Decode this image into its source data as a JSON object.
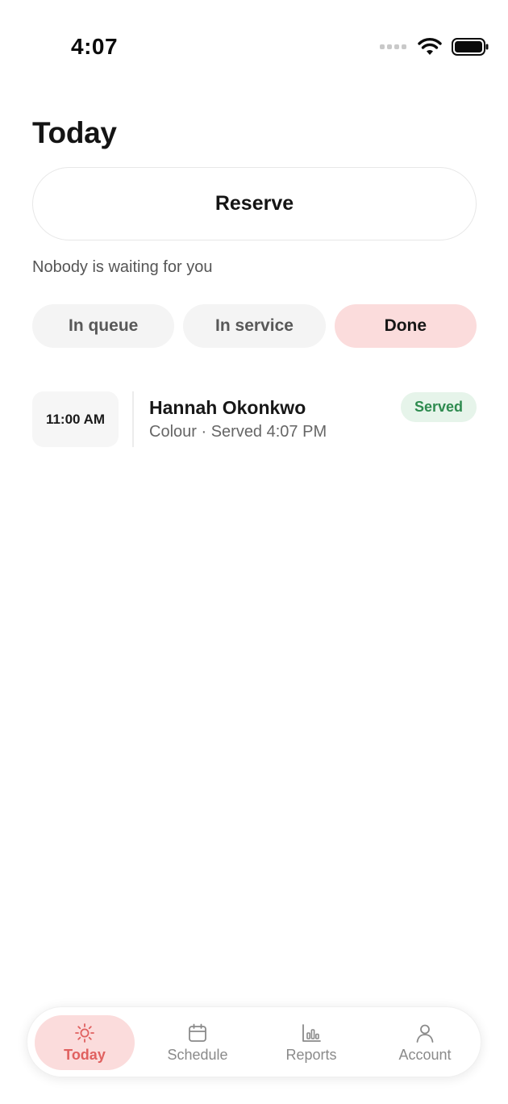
{
  "status_bar": {
    "time": "4:07",
    "icons": [
      "signal-dots-icon",
      "wifi-icon",
      "battery-icon"
    ]
  },
  "page": {
    "title": "Today"
  },
  "reserve": {
    "label": "Reserve"
  },
  "queue_message": "Nobody is waiting for you",
  "tabs": [
    {
      "label": "In queue",
      "active": false
    },
    {
      "label": "In service",
      "active": false
    },
    {
      "label": "Done",
      "active": true
    }
  ],
  "items": [
    {
      "time": "11:00 AM",
      "name": "Hannah Okonkwo",
      "detail": "Colour · Served 4:07 PM",
      "status": "Served"
    }
  ],
  "bottom_nav": [
    {
      "label": "Today",
      "icon": "sun-icon",
      "active": true
    },
    {
      "label": "Schedule",
      "icon": "calendar-icon",
      "active": false
    },
    {
      "label": "Reports",
      "icon": "bar-chart-icon",
      "active": false
    },
    {
      "label": "Account",
      "icon": "person-icon",
      "active": false
    }
  ],
  "colors": {
    "accent": "#e0605f",
    "accent_soft": "#fbdcdc",
    "success_text": "#2e8b4f",
    "success_bg": "#e6f4ea"
  }
}
